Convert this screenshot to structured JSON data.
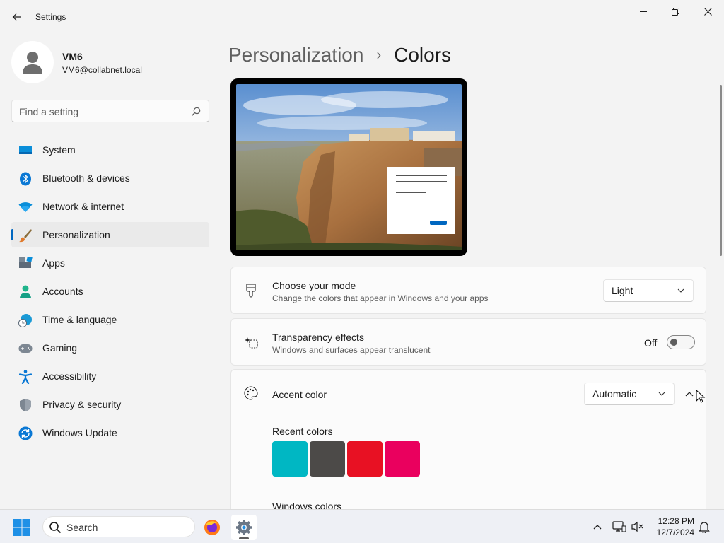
{
  "window": {
    "title": "Settings"
  },
  "profile": {
    "name": "VM6",
    "email": "VM6@collabnet.local"
  },
  "search": {
    "placeholder": "Find a setting"
  },
  "nav": {
    "items": [
      {
        "label": "System",
        "icon": "monitor-icon"
      },
      {
        "label": "Bluetooth & devices",
        "icon": "bluetooth-icon"
      },
      {
        "label": "Network & internet",
        "icon": "wifi-icon"
      },
      {
        "label": "Personalization",
        "icon": "brush-icon",
        "active": true
      },
      {
        "label": "Apps",
        "icon": "apps-icon"
      },
      {
        "label": "Accounts",
        "icon": "person-icon"
      },
      {
        "label": "Time & language",
        "icon": "clock-globe-icon"
      },
      {
        "label": "Gaming",
        "icon": "gamepad-icon"
      },
      {
        "label": "Accessibility",
        "icon": "accessibility-icon"
      },
      {
        "label": "Privacy & security",
        "icon": "shield-icon"
      },
      {
        "label": "Windows Update",
        "icon": "update-icon"
      }
    ]
  },
  "breadcrumb": {
    "parent": "Personalization",
    "separator": "›",
    "current": "Colors"
  },
  "mode_card": {
    "title": "Choose your mode",
    "description": "Change the colors that appear in Windows and your apps",
    "value": "Light"
  },
  "transparency_card": {
    "title": "Transparency effects",
    "description": "Windows and surfaces appear translucent",
    "state_label": "Off"
  },
  "accent_card": {
    "title": "Accent color",
    "value": "Automatic"
  },
  "recent_colors": {
    "title": "Recent colors",
    "swatches": [
      "#00b7c3",
      "#4c4a48",
      "#e81123",
      "#ea005e"
    ]
  },
  "windows_colors": {
    "title": "Windows colors"
  },
  "taskbar": {
    "search_label": "Search",
    "time": "12:28 PM",
    "date": "12/7/2024"
  },
  "colors": {
    "accent": "#0067c0"
  }
}
